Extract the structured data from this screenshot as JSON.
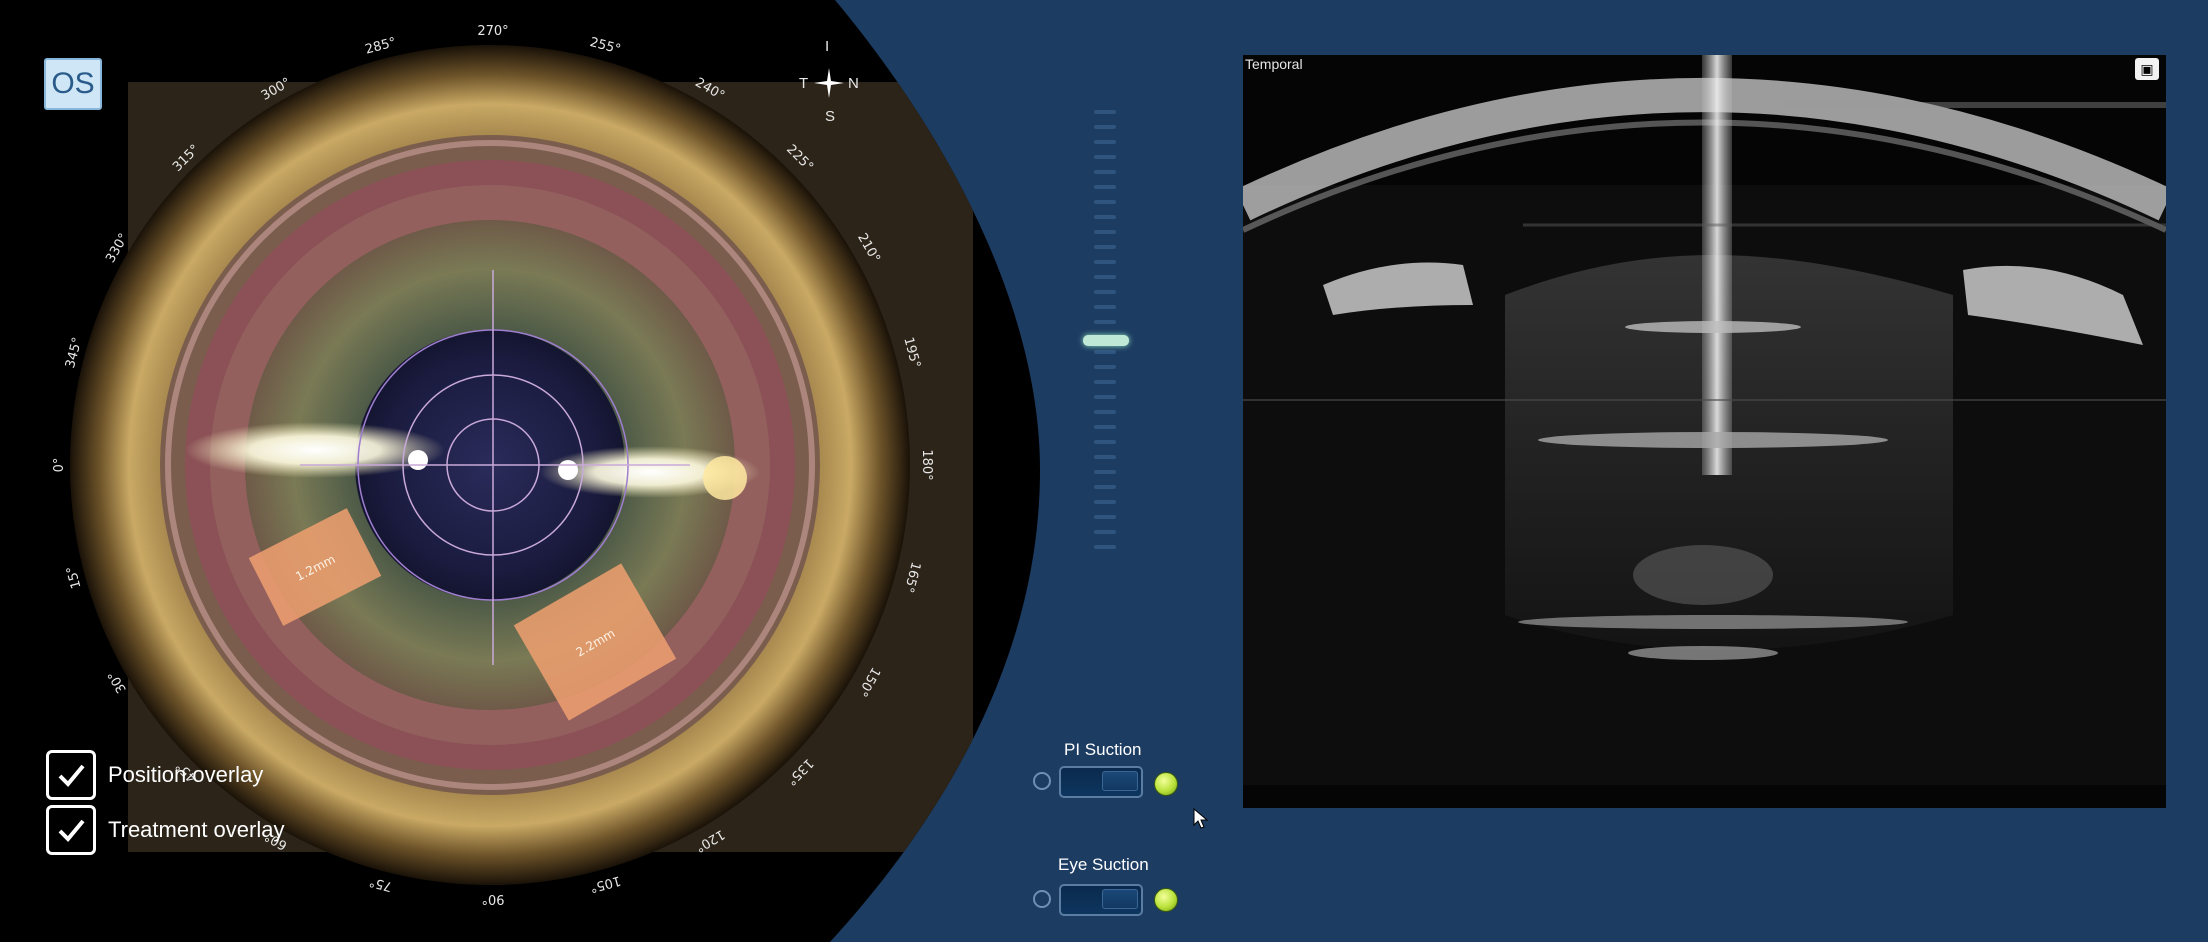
{
  "eye_side": "OS",
  "compass": {
    "top": "I",
    "left": "T",
    "right": "N",
    "bottom": "S"
  },
  "degree_labels": [
    "270°",
    "285°",
    "300°",
    "315°",
    "330°",
    "345°",
    "0°",
    "15°",
    "30°",
    "45°",
    "60°",
    "75°",
    "90°",
    "105°",
    "120°",
    "135°",
    "150°",
    "165°",
    "180°",
    "195°",
    "210°",
    "225°",
    "240°",
    "255°"
  ],
  "incisions": [
    {
      "label": "1.2mm"
    },
    {
      "label": "2.2mm"
    }
  ],
  "overlays": {
    "position": {
      "label": "Position overlay",
      "checked": true
    },
    "treatment": {
      "label": "Treatment overlay",
      "checked": true
    }
  },
  "oct": {
    "orientation_label": "Temporal"
  },
  "suction": {
    "pi": {
      "label": "PI Suction",
      "status": "on"
    },
    "eye": {
      "label": "Eye Suction",
      "status": "on"
    }
  },
  "colors": {
    "background": "#1d3c62",
    "accent_led": "#b9e13a",
    "slider_handle": "#bfe8d6",
    "incision_fill": "#f0a070"
  }
}
